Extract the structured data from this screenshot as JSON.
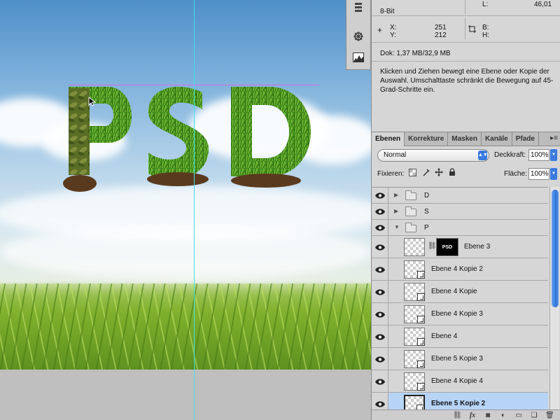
{
  "info_panel": {
    "bit_depth": "8-Bit",
    "l_label": "L:",
    "l_value": "46,01",
    "x_label": "X:",
    "x_value": "251",
    "y_label": "Y:",
    "y_value": "212",
    "b_label": "B:",
    "h_label": "H:",
    "doc_size": "Dok: 1,37 MB/32,9 MB",
    "hint_text": "Klicken und Ziehen bewegt eine Ebene oder Kopie der Auswahl. Umschalttaste schränkt die Bewegung auf 45-Grad-Schritte ein."
  },
  "canvas": {
    "artwork_text": "PSD"
  },
  "layers_panel": {
    "tabs": [
      "Ebenen",
      "Korrekture",
      "Masken",
      "Kanäle",
      "Pfade"
    ],
    "active_tab": "Ebenen",
    "blend_mode": "Normal",
    "opacity_label": "Deckkraft:",
    "opacity_value": "100%",
    "lock_label": "Fixieren:",
    "fill_label": "Fläche:",
    "fill_value": "100%",
    "groups": [
      {
        "name": "D",
        "expanded": false
      },
      {
        "name": "S",
        "expanded": false
      },
      {
        "name": "P",
        "expanded": true
      }
    ],
    "mask_thumb_text": "PSD",
    "layers": [
      "Ebene 3",
      "Ebene 4 Kopie 2",
      "Ebene 4 Kopie",
      "Ebene 4 Kopie 3",
      "Ebene 4",
      "Ebene 5 Kopie 3",
      "Ebene 4 Kopie 4",
      "Ebene 5 Kopie 2"
    ],
    "selected_layer": "Ebene 5 Kopie 2"
  },
  "colors": {
    "guide_vertical": "#3fe0e8",
    "guide_horizontal": "#d66be6",
    "selection": "#b7d4f7",
    "accent": "#3b7be0"
  }
}
